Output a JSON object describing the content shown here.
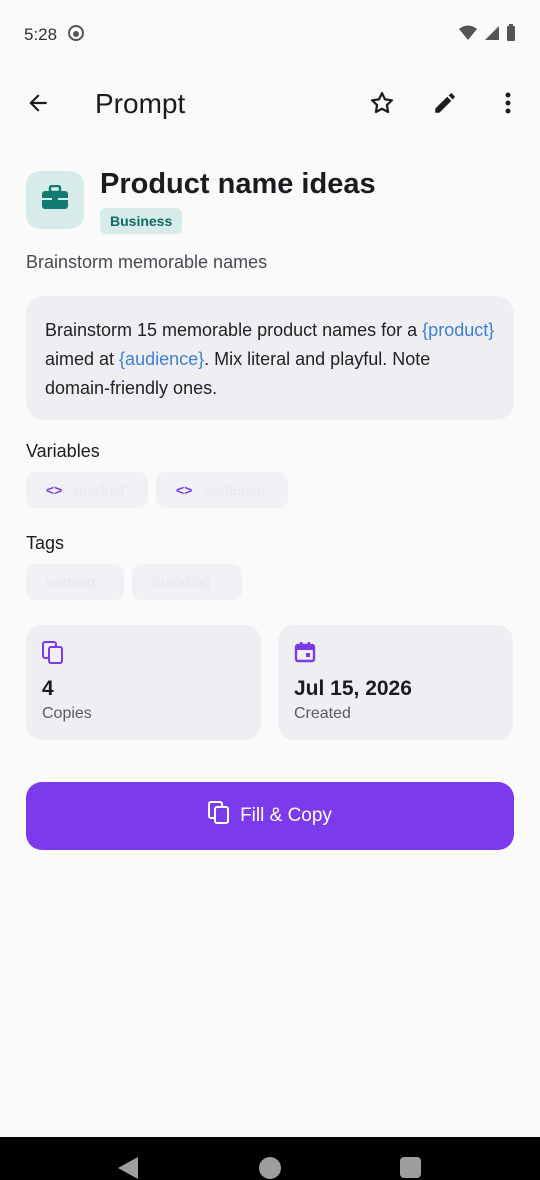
{
  "status_bar": {
    "time": "5:28"
  },
  "app_bar": {
    "title": "Prompt"
  },
  "prompt": {
    "title": "Product name ideas",
    "category": "Business",
    "subtitle": "Brainstorm memorable names",
    "body_segments": [
      {
        "text": "Brainstorm 15 memorable product names for a ",
        "var": false
      },
      {
        "text": "{product}",
        "var": true
      },
      {
        "text": " aimed at ",
        "var": false
      },
      {
        "text": "{audience}",
        "var": true
      },
      {
        "text": ". Mix literal and playful. Note domain-friendly ones.",
        "var": false
      }
    ]
  },
  "variables": {
    "label": "Variables",
    "items": [
      "product",
      "audience"
    ]
  },
  "tags": {
    "label": "Tags",
    "items": [
      "naming",
      "branding"
    ]
  },
  "stats": {
    "copies": {
      "value": "4",
      "label": "Copies"
    },
    "created": {
      "value": "Jul 15, 2026",
      "label": "Created"
    }
  },
  "actions": {
    "fill_copy_label": "Fill & Copy"
  },
  "colors": {
    "accent": "#7c3aed",
    "category_bg": "#d7ecea",
    "category_fg": "#0e6b63",
    "variable": "#3b7fd9"
  }
}
